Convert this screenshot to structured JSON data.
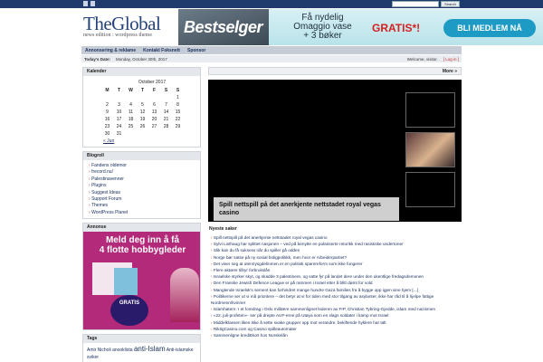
{
  "topbar": {
    "search_button": "Search",
    "search_placeholder": ""
  },
  "header": {
    "logo_title": "TheGlobal",
    "logo_subtitle": "news edition : wordpress theme"
  },
  "banner": {
    "brand": "Bestselger",
    "copy_line1": "Få nydelig",
    "copy_line2": "Omaggio vase",
    "copy_line3": "+ 3 bøker",
    "gratis": "GRATIS*!",
    "cta": "BLI MEDLEM NÅ"
  },
  "nav": {
    "items": [
      "Annonsering & reklame",
      "Kontakt Foksnett",
      "Sponsor"
    ]
  },
  "datebar": {
    "today_label": "Today's Date:",
    "today_value": "Monday, October 30th, 2017",
    "welcome": "Welcome, visitor.",
    "login": "[ Log in ]"
  },
  "calendar": {
    "title": "Kalender",
    "caption": "October 2017",
    "weekdays": [
      "M",
      "T",
      "W",
      "T",
      "F",
      "S",
      "S"
    ],
    "rows": [
      [
        "",
        "",
        "",
        "",
        "",
        "",
        "1"
      ],
      [
        "2",
        "3",
        "4",
        "5",
        "6",
        "7",
        "8"
      ],
      [
        "9",
        "10",
        "11",
        "12",
        "13",
        "14",
        "15"
      ],
      [
        "16",
        "17",
        "18",
        "19",
        "20",
        "21",
        "22"
      ],
      [
        "23",
        "24",
        "25",
        "26",
        "27",
        "28",
        "29"
      ],
      [
        "30",
        "31",
        "",
        "",
        "",
        "",
        ""
      ]
    ],
    "prev": "« Jun"
  },
  "blogroll": {
    "title": "Blogroll",
    "items": [
      "Fandens oldemor",
      "frecord.nu/",
      "Palestinavenner",
      "Plugins",
      "Suggest Ideas",
      "Support Forum",
      "Themes",
      "WordPress Planet"
    ]
  },
  "ad": {
    "title": "Annonse",
    "headline_1": "Meld deg inn å få",
    "headline_2": "4 flotte hobbygleder",
    "gratis": "GRATIS"
  },
  "tags": {
    "title": "Tags",
    "cloud": [
      "Amir Nicholi",
      "anooklista",
      "anti-Islam",
      "Anti-islamske",
      "sviker"
    ]
  },
  "main": {
    "more_label": "More »",
    "video_caption": "Spill nettspill på det anerkjente nettstadet royal vegas casino",
    "newest_title": "Nyeste saker",
    "newest": [
      "Spill nettspill på det anerkjente nettstadet royal vegas casino",
      "Sylvi Listhaug har splittet nasjonen – ved på benytte en polariserte retorikk med rasistiske undertoner",
      "Slik kan du få suksess når du spiller på odden",
      "Norge bør satse på ny sosial boligpolitikk, men hvor er Arbeiderpartiet?",
      "Det viser seg at utenriysgdelinmen er en politisk sparereform som ikke fungerer",
      "Flere aktører tilbyr forbrukslån",
      "Israelske styrker skyt, og skadde 3 palestinere, og satte fyr på landet dere under den ukentlige fredagsdemonen",
      "Den Franske Jewish Defence League er på rammen i Israel etter å blitt dømt for vold",
      "Manglende Israelsk's sement kan forhindret mange hundre Gaza families fra å bygge opp igjen sine hjem [...]",
      "Politikerne ser ut vi må prioritere – det betyr at vi for tiden med stor tilgang av asylanter, ikke har råd til å hjelpe fattige Nordmenn/kvinner",
      "Islamhatern: I et foredrag i Oslo militære sammenlignet lederen av FrP, Christian Tybring-Gjedde, islam med nazismen",
      "«22. juli-profeten»- ser på drepte AUF-erne på Utøya som en slags soldater i kamp mot Israel",
      "Middelklassen likes ikke å sette svake grupper opp mot verandre, bekiftende hyklere har talt",
      "RiktigCasino.com og Casino spilleautomater",
      "Sammenligne kredittkort hos Norskelån"
    ]
  },
  "colors": {
    "topbar": "#1f3a6d",
    "accent": "#c0302a",
    "link": "#1d3360",
    "ad_bg": "#b42a7a",
    "cta": "#1d9bc4"
  }
}
